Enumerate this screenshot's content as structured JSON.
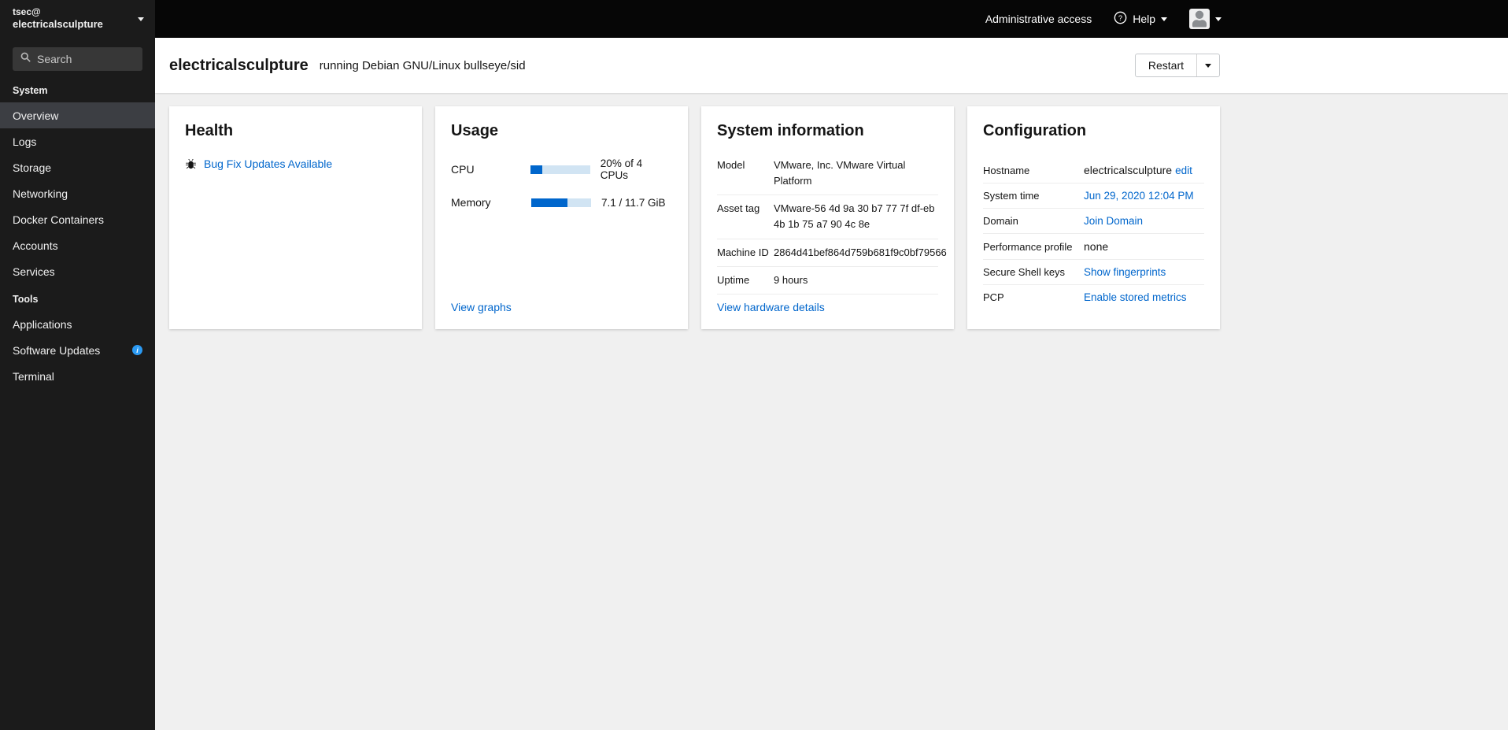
{
  "colors": {
    "accent_blue": "#0066cc",
    "info_blue": "#2b9af3",
    "progress_track": "#d1e4f3",
    "sidebar_bg": "#1b1b1b"
  },
  "sidebar": {
    "user_line1": "tsec@",
    "user_line2": "electricalsculpture",
    "search_placeholder": "Search",
    "active": "Overview",
    "sections": [
      {
        "label": "System",
        "items": [
          {
            "label": "Overview"
          },
          {
            "label": "Logs"
          },
          {
            "label": "Storage"
          },
          {
            "label": "Networking"
          },
          {
            "label": "Docker Containers"
          },
          {
            "label": "Accounts"
          },
          {
            "label": "Services"
          }
        ]
      },
      {
        "label": "Tools",
        "items": [
          {
            "label": "Applications"
          },
          {
            "label": "Software Updates",
            "badge": "info"
          },
          {
            "label": "Terminal"
          }
        ]
      }
    ]
  },
  "topbar": {
    "admin_access": "Administrative access",
    "help_label": "Help"
  },
  "masthead": {
    "hostname": "electricalsculpture",
    "os_text": "running Debian GNU/Linux bullseye/sid",
    "restart_label": "Restart"
  },
  "cards": {
    "health": {
      "title": "Health",
      "link_label": "Bug Fix Updates Available"
    },
    "usage": {
      "title": "Usage",
      "rows": [
        {
          "label": "CPU",
          "percent": 20,
          "value": "20% of 4 CPUs"
        },
        {
          "label": "Memory",
          "percent": 61,
          "value": "7.1 / 11.7 GiB"
        }
      ],
      "link_label": "View graphs"
    },
    "system_information": {
      "title": "System information",
      "rows": [
        {
          "label": "Model",
          "value": "VMware, Inc. VMware Virtual Platform"
        },
        {
          "label": "Asset tag",
          "value": "VMware-56 4d 9a 30 b7 77 7f df-eb 4b 1b 75 a7 90 4c 8e"
        },
        {
          "label": "Machine ID",
          "value": "2864d41bef864d759b681f9c0bf79566"
        },
        {
          "label": "Uptime",
          "value": "9 hours"
        }
      ],
      "link_label": "View hardware details"
    },
    "configuration": {
      "title": "Configuration",
      "rows": [
        {
          "label": "Hostname",
          "value": "electricalsculpture",
          "link": "edit"
        },
        {
          "label": "System time",
          "link": "Jun 29, 2020 12:04 PM"
        },
        {
          "label": "Domain",
          "link": "Join Domain"
        },
        {
          "label": "Performance profile",
          "value": "none"
        },
        {
          "label": "Secure Shell keys",
          "link": "Show fingerprints"
        },
        {
          "label": "PCP",
          "link": "Enable stored metrics"
        }
      ]
    }
  }
}
